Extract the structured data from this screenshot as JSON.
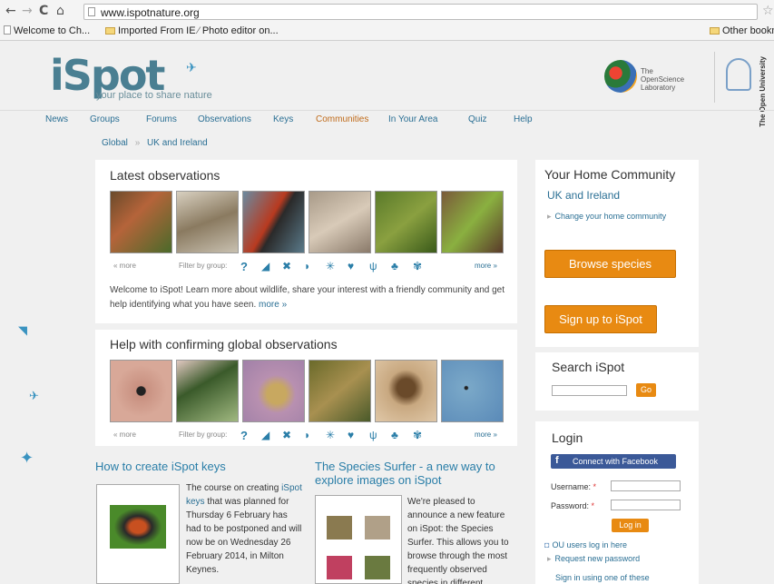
{
  "browser": {
    "url": "www.ispotnature.org",
    "bookmarks": [
      "Welcome to Ch...",
      "Imported From IE",
      "Photo editor on...",
      "Other bookm"
    ]
  },
  "header": {
    "logo": "iSpot",
    "tagline": "your place to share nature",
    "osl": "The OpenScience Laboratory",
    "ou": "The Open University"
  },
  "nav": {
    "items": [
      "News",
      "Groups",
      "Forums",
      "Observations",
      "Keys",
      "Communities",
      "In Your Area",
      "Quiz",
      "Help"
    ]
  },
  "breadcrumb": {
    "global": "Global",
    "sep": "»",
    "current": "UK and Ireland"
  },
  "latest": {
    "title": "Latest observations",
    "prev": "« more",
    "filter": "Filter by group:",
    "next": "more »",
    "welcome": "Welcome to iSpot! Learn more about wildlife, share your interest with a friendly community and get help identifying what you have seen.",
    "welcome_more": "more »"
  },
  "help": {
    "title": "Help with confirming global observations",
    "prev": "« more",
    "filter": "Filter by group:",
    "next": "more »"
  },
  "articles": {
    "keys_title": "How to create iSpot keys",
    "keys_text_1": "The course on creating",
    "keys_link": "iSpot keys",
    "keys_text_2": "that was planned for Thursday 6 February has had to be postponed and will now be on Wednesday 26 February 2014, in Milton Keynes.",
    "surfer_title": "The Species Surfer - a new way to explore images on iSpot",
    "surfer_text": "We're pleased to announce a new feature on iSpot: the Species Surfer. This allows you to browse through the most frequently observed species in different groups"
  },
  "sidebar": {
    "home_title": "Your Home Community",
    "home_name": "UK and Ireland",
    "change": "Change your home community",
    "browse": "Browse species",
    "signup": "Sign up to iSpot",
    "search_title": "Search iSpot",
    "go": "Go",
    "login_title": "Login",
    "fb": "Connect with Facebook",
    "username": "Username:",
    "password": "Password:",
    "login_btn": "Log in",
    "ou_login": "OU users log in here",
    "request_pw": "Request new password",
    "sign_in_other": "Sign in using one of these"
  }
}
